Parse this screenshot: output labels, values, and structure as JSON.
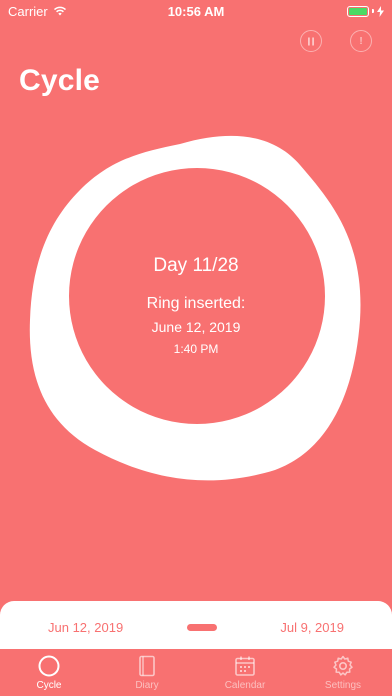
{
  "status_bar": {
    "carrier": "Carrier",
    "time": "10:56 AM"
  },
  "header": {
    "title": "Cycle",
    "pause_icon": "pause-icon",
    "info_icon": "info-icon",
    "info_glyph": "!"
  },
  "ring": {
    "day_counter": "Day 11/28",
    "label": "Ring inserted:",
    "date": "June 12, 2019",
    "time": "1:40 PM"
  },
  "date_range": {
    "start": "Jun 12, 2019",
    "end": "Jul 9, 2019"
  },
  "tabs": [
    {
      "label": "Cycle",
      "icon": "circle-icon",
      "active": true
    },
    {
      "label": "Diary",
      "icon": "book-icon",
      "active": false
    },
    {
      "label": "Calendar",
      "icon": "calendar-icon",
      "active": false
    },
    {
      "label": "Settings",
      "icon": "gear-icon",
      "active": false
    }
  ],
  "colors": {
    "background": "#F87171",
    "accent": "#FFFFFF",
    "battery": "#4CD964"
  }
}
